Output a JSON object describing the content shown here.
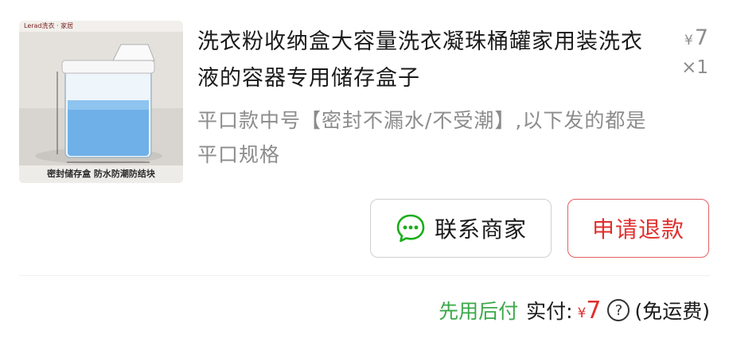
{
  "product": {
    "image_top_text": "Lerad洗衣 · 家居",
    "image_caption": "密封储存盒 防水防潮防结块",
    "title": "洗衣粉收纳盒大容量洗衣凝珠桶罐家用装洗衣液的容器专用储存盒子",
    "spec": "平口款中号【密封不漏水/不受潮】,以下发的都是平口规格",
    "price_symbol": "¥",
    "price": "7",
    "quantity": "×1"
  },
  "actions": {
    "contact_label": "联系商家",
    "refund_label": "申请退款"
  },
  "footer": {
    "bnpl": "先用后付",
    "paid_label": "实付:",
    "paid_symbol": "¥",
    "paid_amount": "7",
    "help_glyph": "?",
    "shipping": "(免运费)"
  },
  "colors": {
    "accent_red": "#e0302e",
    "bnpl_green": "#3aa84a",
    "chat_icon_green": "#1aad19",
    "muted_text": "#8c8c8c"
  },
  "icons": [
    "chat-bubble-icon",
    "question-circle-icon"
  ]
}
